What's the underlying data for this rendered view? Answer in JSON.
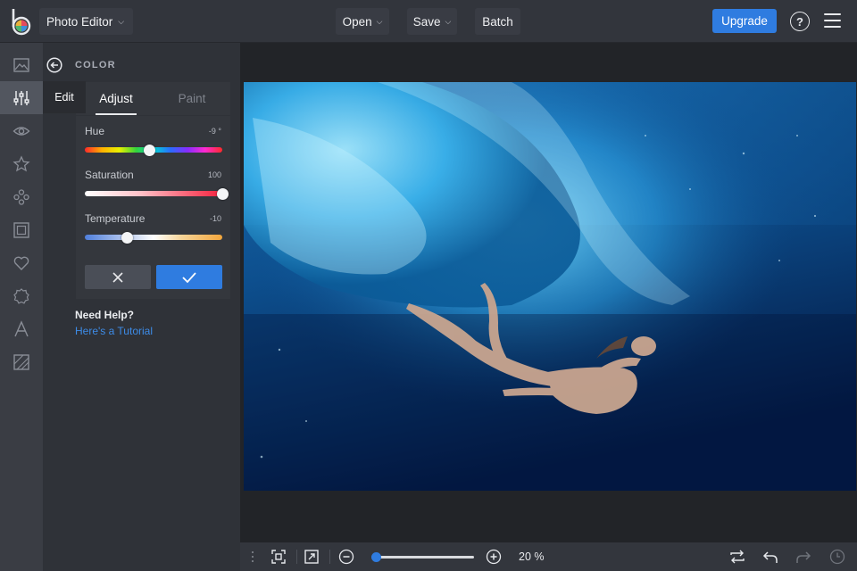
{
  "header": {
    "app_menu": "Photo Editor",
    "open": "Open",
    "save": "Save",
    "batch": "Batch",
    "upgrade": "Upgrade",
    "help_glyph": "?"
  },
  "rail": {
    "items": [
      "image-icon",
      "sliders-icon",
      "eye-icon",
      "star-icon",
      "shapes-icon",
      "frame-icon",
      "heart-icon",
      "badge-icon",
      "text-icon",
      "texture-icon"
    ],
    "active": "sliders-icon",
    "tooltip": "Edit"
  },
  "panel": {
    "title": "COLOR",
    "tabs": {
      "adjust": "Adjust",
      "paint": "Paint"
    },
    "controls": [
      {
        "label": "Hue",
        "value": "-9 °",
        "fraction": 0.47
      },
      {
        "label": "Saturation",
        "value": "100",
        "fraction": 1.0
      },
      {
        "label": "Temperature",
        "value": "-10",
        "fraction": 0.31
      }
    ],
    "need_help": "Need Help?",
    "tutorial_link": "Here's a Tutorial"
  },
  "bottombar": {
    "zoom_text": "20 %",
    "zoom_fraction": 0.05
  },
  "colors": {
    "accent": "#2f7ce0",
    "panel_bg": "#2f3238",
    "topbar_bg": "#32353c"
  }
}
